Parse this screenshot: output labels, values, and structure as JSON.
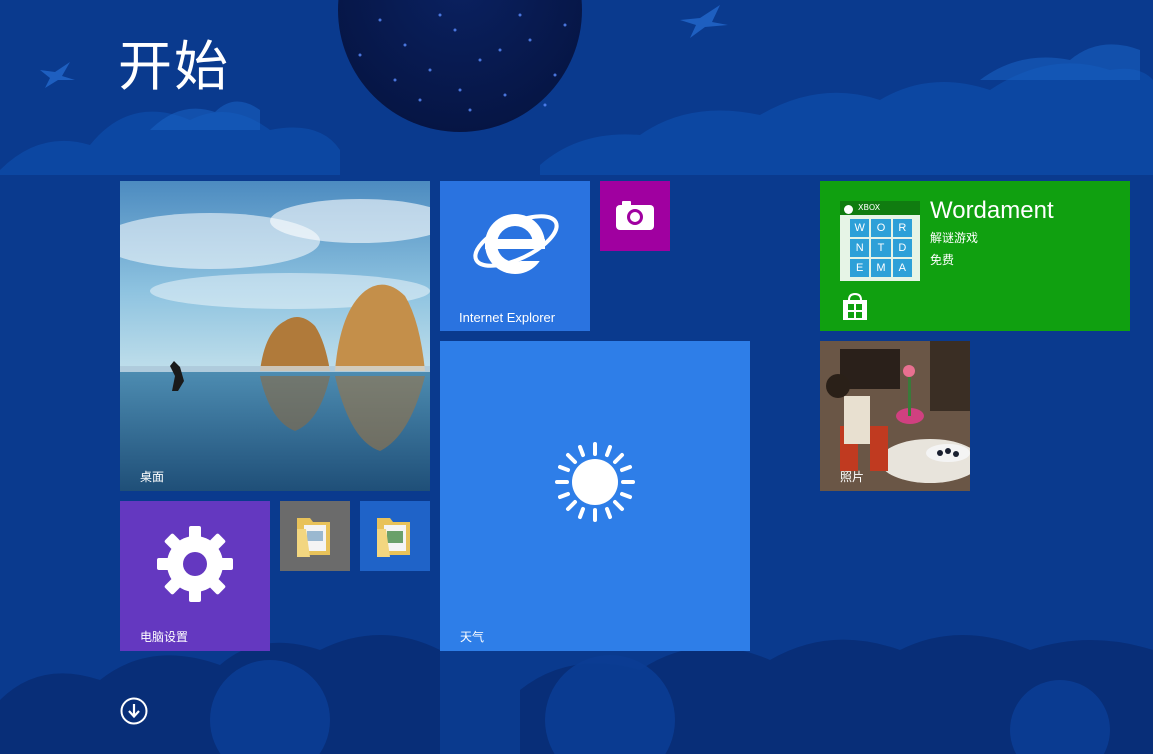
{
  "header": {
    "title": "开始"
  },
  "tiles": {
    "desktop": {
      "label": "桌面"
    },
    "ie": {
      "label": "Internet Explorer",
      "icon": "internet-explorer-icon"
    },
    "camera": {
      "icon": "camera-icon"
    },
    "wordament": {
      "title": "Wordament",
      "subtitle": "解谜游戏",
      "price": "免费",
      "badge": "XBOX",
      "grid": [
        "W",
        "O",
        "R",
        "N",
        "T",
        "D",
        "E",
        "M",
        "A"
      ]
    },
    "settings": {
      "label": "电脑设置",
      "icon": "gear-icon"
    },
    "folder1": {
      "icon": "folder-icon"
    },
    "folder2": {
      "icon": "folder-icon"
    },
    "weather": {
      "label": "天气",
      "icon": "sun-icon"
    },
    "photos": {
      "label": "照片"
    }
  },
  "footer": {
    "icon": "arrow-down-circle-icon"
  },
  "colors": {
    "background": "#0a3a8e",
    "ie": "#2a73e0",
    "camera": "#a000a0",
    "wordament": "#10a010",
    "settings": "#6438c0",
    "weather": "#2e7ee8"
  }
}
